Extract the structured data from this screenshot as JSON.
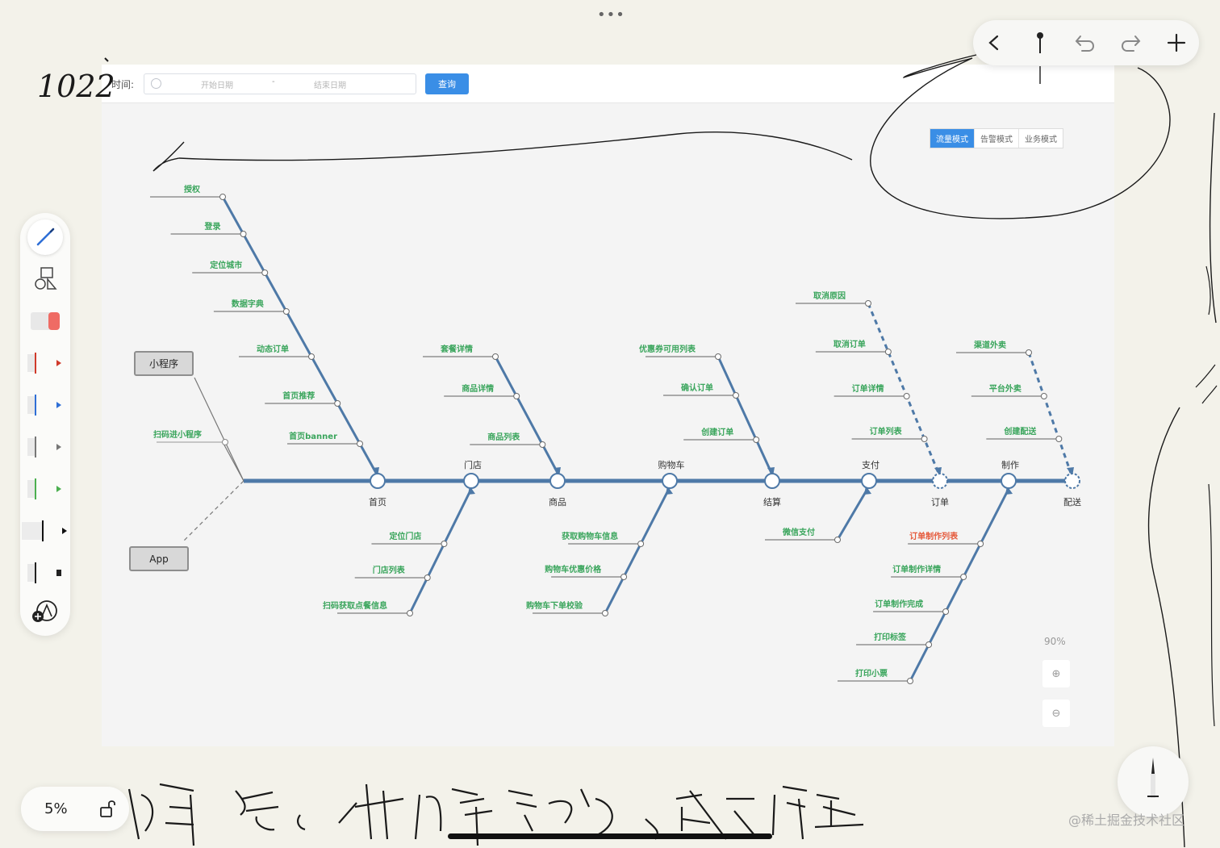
{
  "screenshot": {
    "filter": {
      "time_label": "时间:",
      "start_placeholder": "开始日期",
      "separator": "-",
      "end_placeholder": "结束日期",
      "query_label": "查询"
    },
    "modes": [
      {
        "label": "流量模式",
        "active": true
      },
      {
        "label": "告警模式",
        "active": false
      },
      {
        "label": "业务模式",
        "active": false
      }
    ],
    "zoom": {
      "level": "90%",
      "zoom_in": "⊕",
      "zoom_out": "⊖"
    },
    "clients": {
      "miniprogram": "小程序",
      "app": "App"
    },
    "scan_miniprogram": "扫码进小程序",
    "spine_nodes": [
      "首页",
      "门店",
      "商品",
      "购物车",
      "结算",
      "支付",
      "订单",
      "制作",
      "配送"
    ],
    "branches": {
      "home_top": [
        "授权",
        "登录",
        "定位城市",
        "数据字典",
        "动态订单",
        "首页推荐",
        "首页banner"
      ],
      "goods_top": [
        "套餐详情",
        "商品详情",
        "商品列表"
      ],
      "settle_top": [
        "优惠券可用列表",
        "确认订单",
        "创建订单"
      ],
      "order_top": [
        "取消原因",
        "取消订单",
        "订单详情",
        "订单列表"
      ],
      "delivery_top": [
        "渠道外卖",
        "平台外卖",
        "创建配送"
      ],
      "store_bottom": [
        "定位门店",
        "门店列表",
        "扫码获取点餐信息"
      ],
      "cart_bottom": [
        "获取购物车信息",
        "购物车优惠价格",
        "购物车下单校验"
      ],
      "pay_bottom": [
        "微信支付"
      ],
      "make_bottom": [
        "订单制作列表",
        "订单制作详情",
        "订单制作完成",
        "打印标签",
        "打印小票"
      ]
    }
  },
  "ink": {
    "date": "1022"
  },
  "canvas_ui": {
    "zoom_percent": "5%",
    "watermark": "@稀土掘金技术社区"
  },
  "colors": {
    "spine": "#4e79a7",
    "label": "#3aa55c",
    "alert": "#e55a3c",
    "accent": "#3a8ee6",
    "ink": "#1a1a1a"
  },
  "icons": [
    "back-icon",
    "pin-icon",
    "undo-icon",
    "redo-icon",
    "add-icon",
    "pen-icon",
    "shapes-icon",
    "eraser-icon",
    "marker-red-icon",
    "marker-blue-icon",
    "marker-gray-icon",
    "marker-green-icon",
    "marker-black-icon",
    "marker-dark-icon",
    "add-tool-icon",
    "lock-icon",
    "pencil-icon"
  ]
}
